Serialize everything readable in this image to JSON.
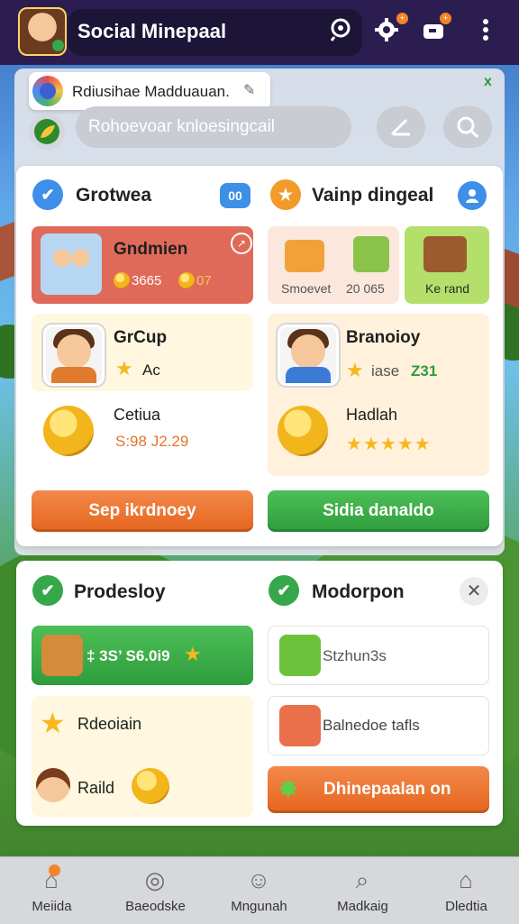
{
  "topbar": {
    "app_title": "Social Minepaal",
    "notification_badge": "+",
    "mail_badge": "+"
  },
  "toast": {
    "text": "Rdiusihae Madduauan."
  },
  "search": {
    "placeholder": "Rohoevoar knloesingcail"
  },
  "left_section": {
    "title": "Grotwea",
    "badge": "00",
    "player_tile": {
      "name": "Gndmien",
      "coins": "3665",
      "level": "07"
    },
    "group_tile": {
      "name": "GrCup",
      "stat": "Ac"
    },
    "coins_tile": {
      "label": "Cetiua",
      "value": "S:98 J2.29"
    },
    "button_label": "Sep ikrdnoey"
  },
  "right_section": {
    "title": "Vainp dingeal",
    "gift_tile_1": {
      "label": "Smoevet",
      "value": "20 065"
    },
    "gift_tile_2": {
      "label": "Ke rand"
    },
    "player_tile": {
      "name": "Branoioy",
      "stat_label": "iase",
      "stat_value": "Z31"
    },
    "coins_tile": {
      "label": "Hadlah",
      "rating": 5
    },
    "button_label": "Sidia danaldo"
  },
  "bottom_left": {
    "title": "Prodesloy",
    "reward_row": "‡ 3S’ S6.0i9",
    "item_1": "Rdeoiain",
    "item_2": "Raild"
  },
  "bottom_right": {
    "title": "Modorpon",
    "row_1": "Stzhun3s",
    "row_2": "Balnedoe tafls",
    "button_label": "Dhinepaalan on"
  },
  "bottomnav": {
    "items": [
      {
        "label": "Meiida",
        "icon": "home-icon"
      },
      {
        "label": "Baeodske",
        "icon": "camera-icon"
      },
      {
        "label": "Mngunah",
        "icon": "person-icon"
      },
      {
        "label": "Madkaig",
        "icon": "search-icon"
      },
      {
        "label": "Dledtia",
        "icon": "house-icon"
      }
    ]
  },
  "colors": {
    "topbar": "#2b1d4f",
    "orange": "#e5661f",
    "green": "#2f9c3c",
    "blue": "#3d8fe8"
  }
}
